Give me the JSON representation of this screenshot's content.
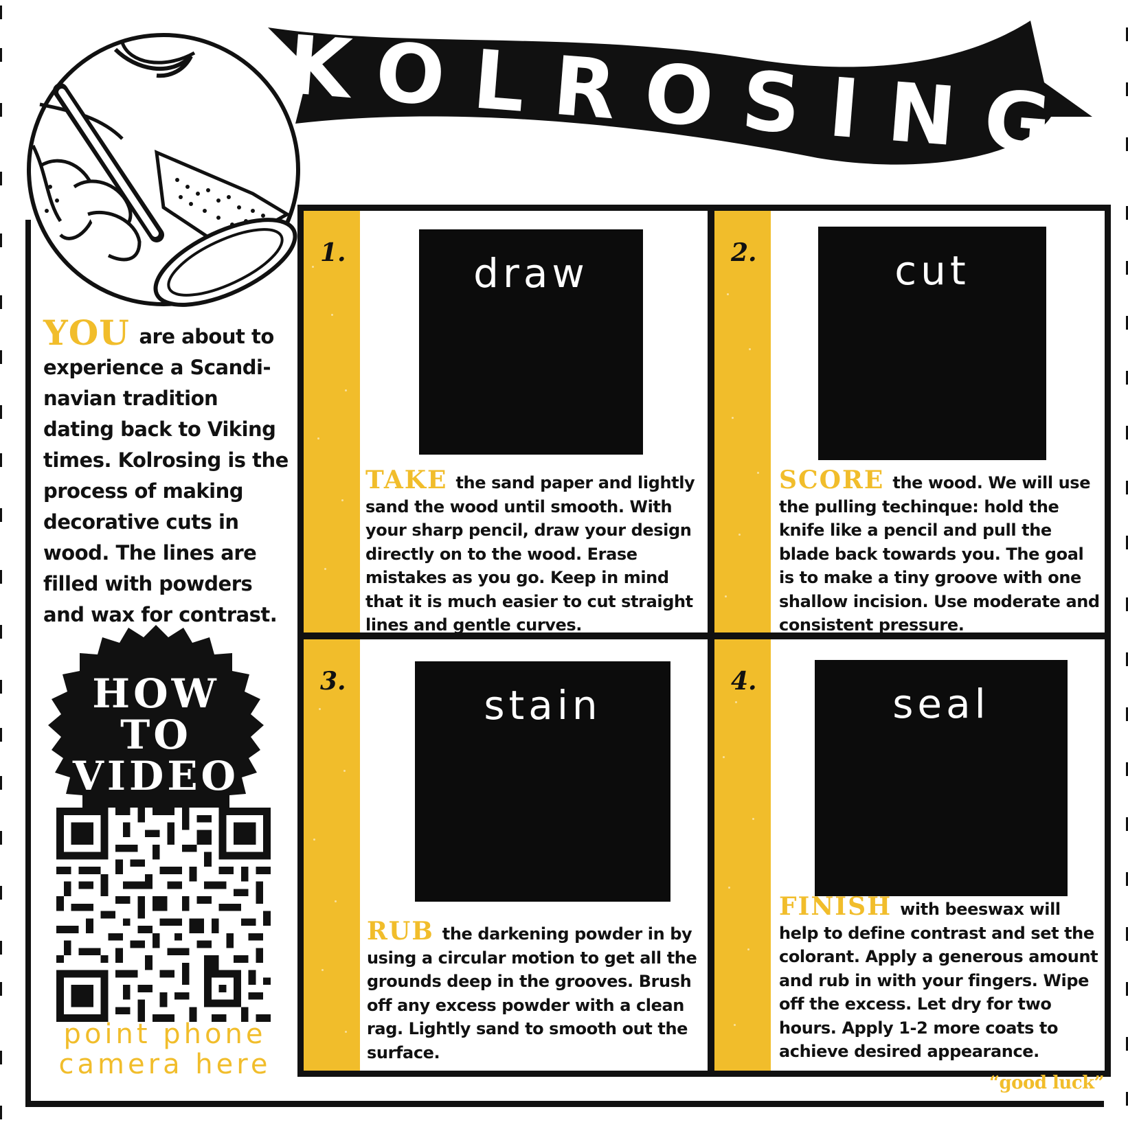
{
  "header": {
    "title": "KOLROSING"
  },
  "intro": {
    "lead": "YOU",
    "text": "are about to experience a Scandi-navian tradition dating back to Viking times. Kolrosing is the process of making decorative cuts in wood. The lines are filled with powders and wax for contrast."
  },
  "video": {
    "badge_lines": [
      "HOW",
      "TO",
      "VIDEO"
    ],
    "caption_lines": [
      "point phone",
      "camera here"
    ]
  },
  "steps": [
    {
      "number": "1.",
      "label": "draw",
      "keyword": "TAKE",
      "text": "the sand paper and lightly sand the wood until smooth. With your sharp pencil, draw your design directly on to the wood. Erase mistakes as you go. Keep in mind that it is much easier to cut straight lines and gentle curves."
    },
    {
      "number": "2.",
      "label": "cut",
      "keyword": "SCORE",
      "text": "the wood. We will use the pulling techinque: hold the knife like a pencil and pull the blade back towards you. The goal is to make a tiny groove with one shallow incision. Use moderate and consistent pressure."
    },
    {
      "number": "3.",
      "label": "stain",
      "keyword": "RUB",
      "text": "the darkening powder in by using a circular motion to get all the grounds deep in the grooves. Brush off any excess powder with a clean rag. Lightly sand to smooth out the surface."
    },
    {
      "number": "4.",
      "label": "seal",
      "keyword": "FINISH",
      "text": "with beeswax will help to define contrast and set the colorant. Apply a generous amount and rub in with your fingers. Wipe off the excess. Let dry for two hours. Apply 1-2 more coats to achieve desired appearance."
    }
  ],
  "footer": {
    "signoff": "“good luck”"
  },
  "colors": {
    "accent": "#f1bd2b",
    "ink": "#111111",
    "paper": "#ffffff"
  },
  "icons": {
    "emblem": "hand-carving-wood-icon",
    "badge": "scalloped-badge-icon",
    "qr": "qr-code-icon"
  }
}
